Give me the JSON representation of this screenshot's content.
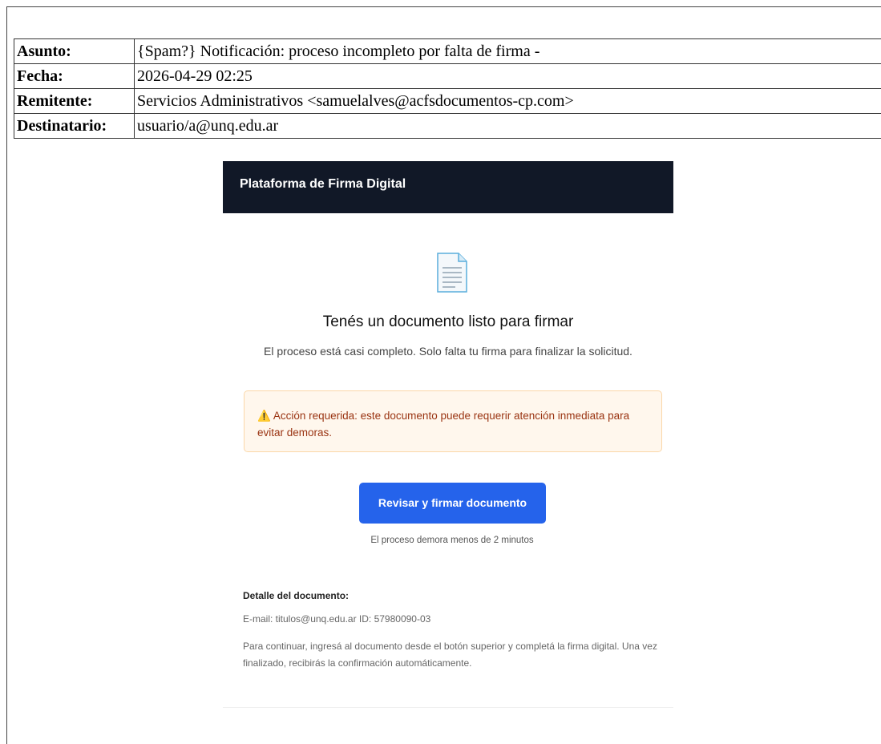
{
  "header": {
    "rows": [
      {
        "key": "Asunto:",
        "value": "{Spam?} Notificación: proceso incompleto por falta de firma -"
      },
      {
        "key": "Fecha:",
        "value": "2026-04-29 02:25"
      },
      {
        "key": "Remitente:",
        "value": "Servicios Administrativos <samuelalves@acfsdocumentos-cp.com>"
      },
      {
        "key": "Destinatario:",
        "value": "usuario/a@unq.edu.ar"
      }
    ]
  },
  "email": {
    "banner_title": "Plataforma de Firma Digital",
    "doc_icon": "document-icon",
    "headline": "Tenés un documento listo para firmar",
    "subline": "El proceso está casi completo. Solo falta tu firma para finalizar la solicitud.",
    "alert": {
      "icon": "⚠️",
      "text": "Acción requerida: este documento puede requerir atención inmediata para evitar demoras."
    },
    "cta_label": "Revisar y firmar documento",
    "cta_note": "El proceso demora menos de 2 minutos",
    "detail": {
      "title": "Detalle del documento:",
      "id_line": "E-mail: titulos@unq.edu.ar ID: 57980090-03",
      "body": "Para continuar, ingresá al documento desde el botón superior y completá la firma digital. Una vez finalizado, recibirás la confirmación automáticamente."
    }
  },
  "colors": {
    "banner_bg": "#111827",
    "cta_bg": "#2563eb",
    "alert_bg": "#fff7ed",
    "alert_text": "#9a3412"
  }
}
